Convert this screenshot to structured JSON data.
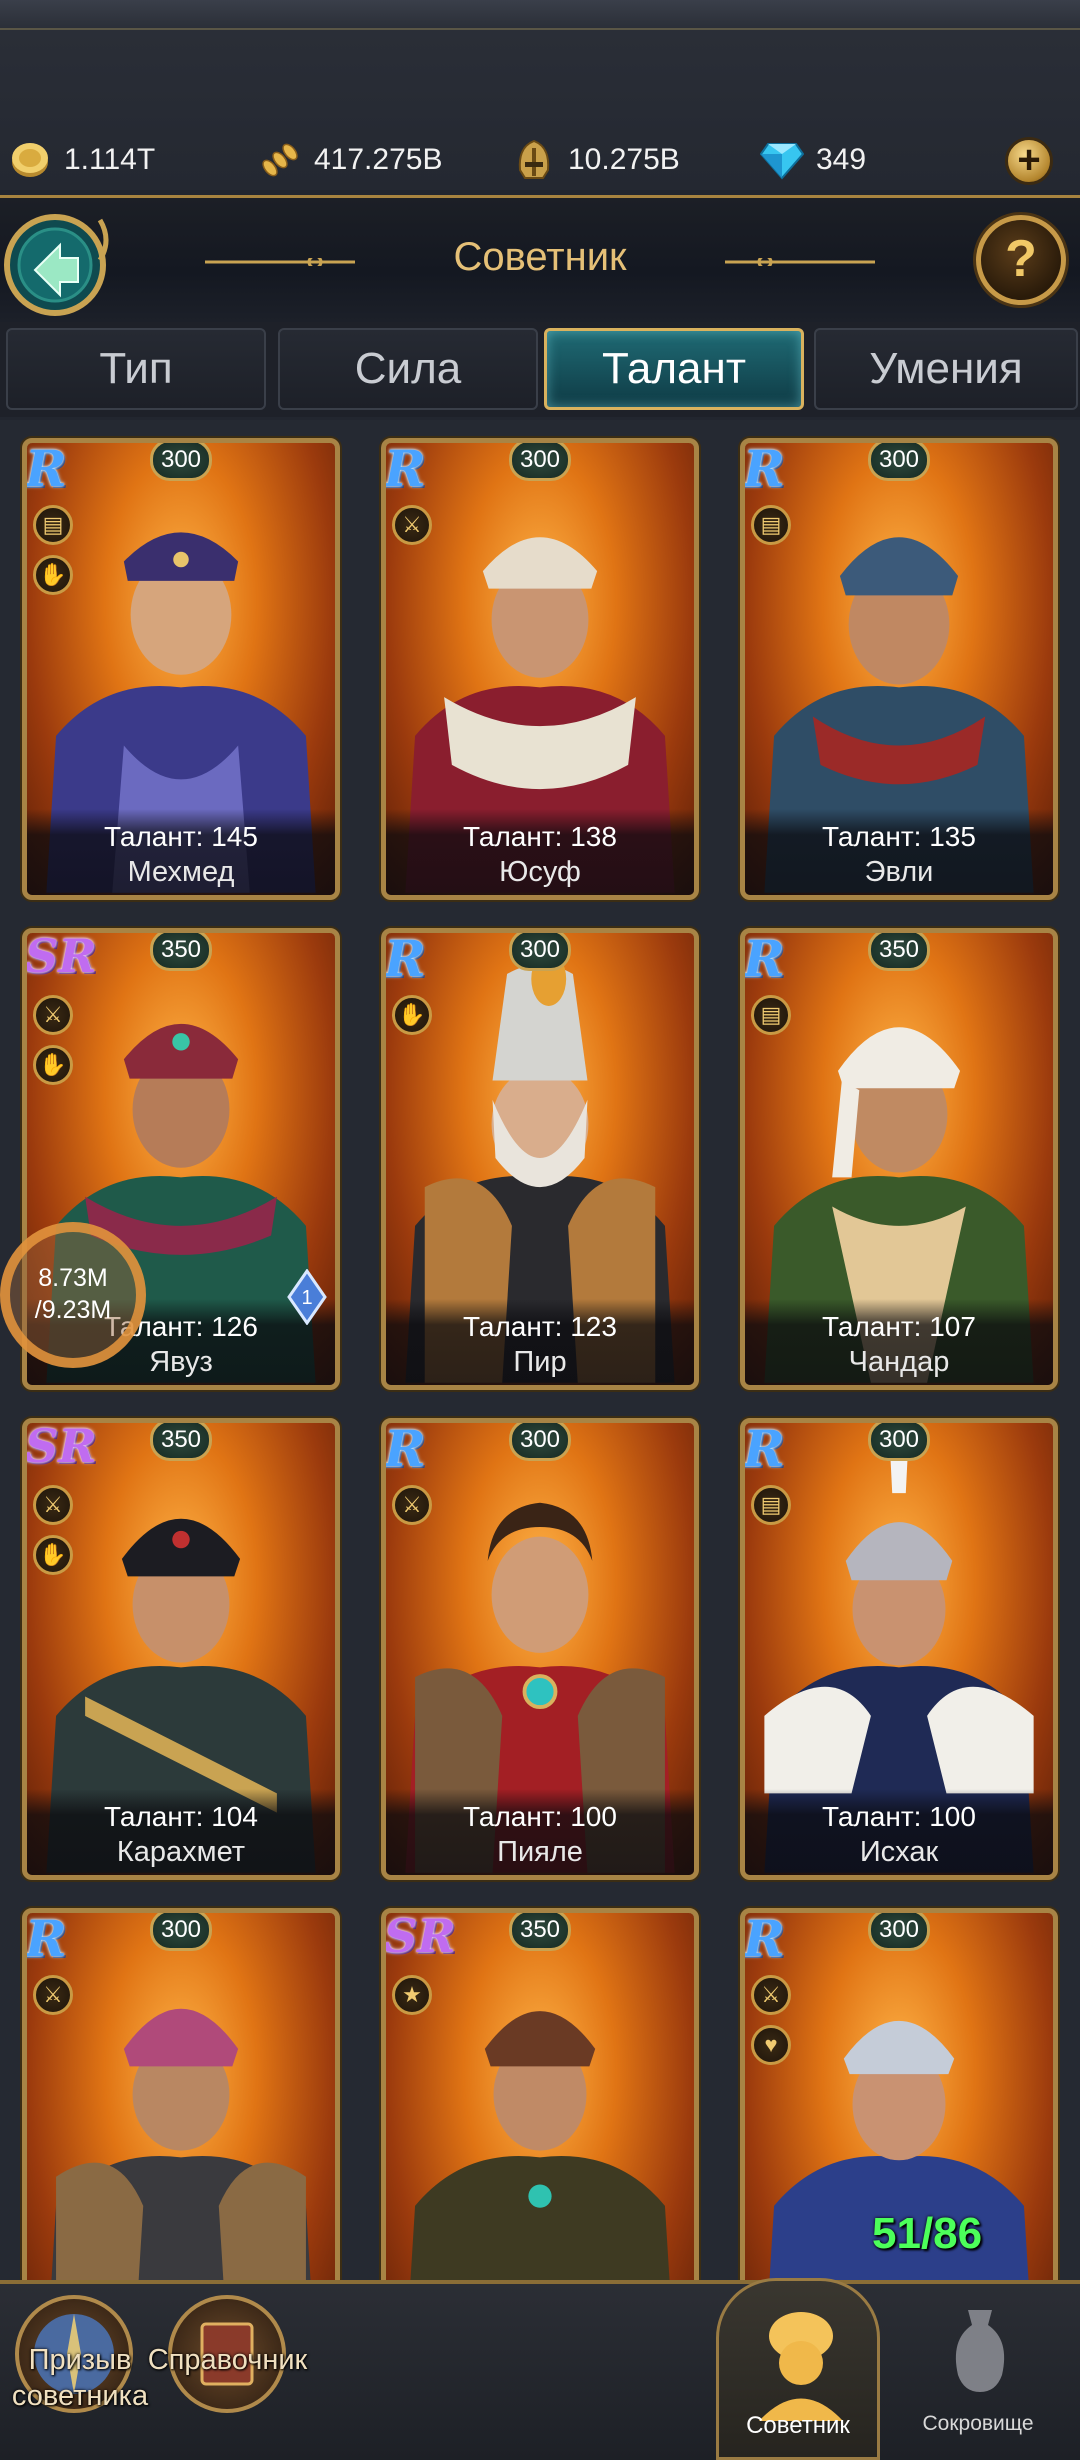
{
  "resources": {
    "gold": "1.114T",
    "food": "417.275B",
    "troops": "10.275B",
    "gems": "349"
  },
  "header": {
    "title": "Советник"
  },
  "tabs": [
    {
      "label": "Тип"
    },
    {
      "label": "Сила"
    },
    {
      "label": "Талант"
    },
    {
      "label": "Умения"
    }
  ],
  "active_tab": "Талант",
  "cards": [
    {
      "rarity": "R",
      "level": "300",
      "talent": "Талант: 145",
      "name": "Мехмед"
    },
    {
      "rarity": "R",
      "level": "300",
      "talent": "Талант: 138",
      "name": "Юсуф"
    },
    {
      "rarity": "R",
      "level": "300",
      "talent": "Талант: 135",
      "name": "Эвли"
    },
    {
      "rarity": "SR",
      "level": "350",
      "talent": "Талант: 126",
      "name": "Явуз"
    },
    {
      "rarity": "R",
      "level": "300",
      "talent": "Талант: 123",
      "name": "Пир"
    },
    {
      "rarity": "R",
      "level": "350",
      "talent": "Талант: 107",
      "name": "Чандар"
    },
    {
      "rarity": "SR",
      "level": "350",
      "talent": "Талант: 104",
      "name": "Карахмет"
    },
    {
      "rarity": "R",
      "level": "300",
      "talent": "Талант: 100",
      "name": "Пияле"
    },
    {
      "rarity": "R",
      "level": "300",
      "talent": "Талант: 100",
      "name": "Исхак"
    },
    {
      "rarity": "R",
      "level": "300",
      "talent": "",
      "name": ""
    },
    {
      "rarity": "SR",
      "level": "350",
      "talent": "",
      "name": ""
    },
    {
      "rarity": "R",
      "level": "300",
      "talent": "",
      "name": ""
    }
  ],
  "timer": {
    "line1": "8.73M",
    "line2": "/9.23M"
  },
  "counter": "51/86",
  "bottom_nav": {
    "summon": "Призыв советника",
    "reference": "Справочник",
    "advisor": "Советник",
    "treasure": "Сокровище"
  },
  "colors": {
    "accent_gold": "#e5c077",
    "active_tab": "#1f6a74",
    "counter": "#4cff5a"
  }
}
